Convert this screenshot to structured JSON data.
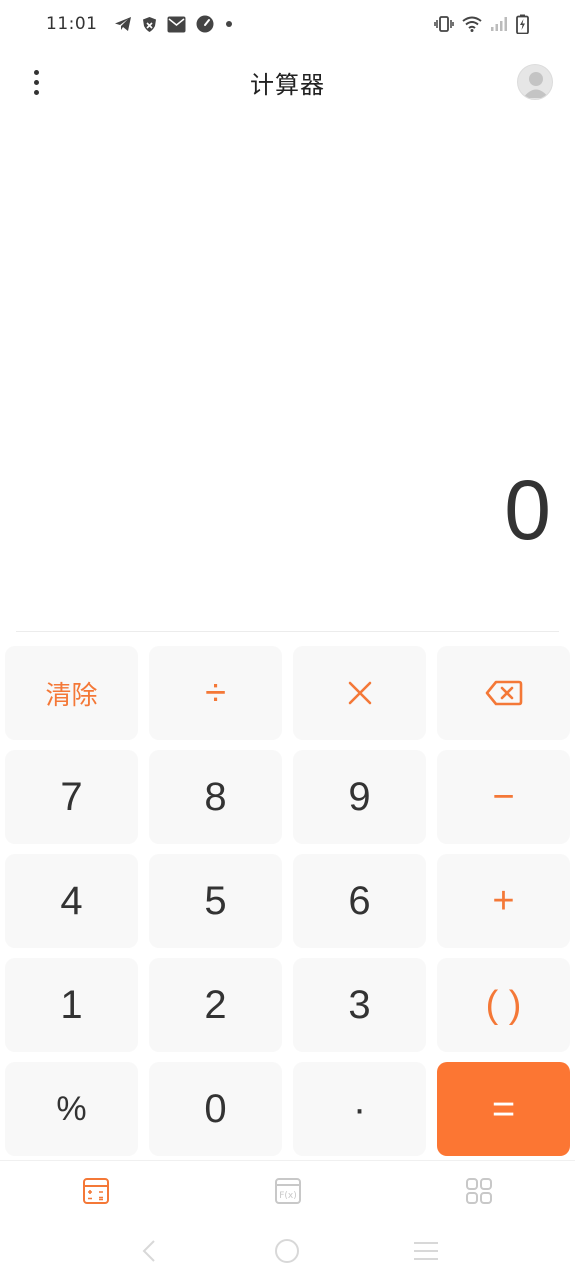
{
  "status_bar": {
    "time": "11:01",
    "left_icons": [
      "telegram-icon",
      "shield-icon",
      "mail-icon",
      "speedometer-icon",
      "dot-icon"
    ],
    "right_icons": [
      "vibrate-icon",
      "wifi-icon",
      "cellular-signal-icon",
      "battery-charging-icon"
    ]
  },
  "header": {
    "title": "计算器",
    "menu_icon": "more-vertical-icon",
    "avatar_icon": "user-avatar-icon"
  },
  "display": {
    "value": "0"
  },
  "keypad": {
    "row1": [
      "清除",
      "÷",
      "×",
      "⌫"
    ],
    "row2": [
      "7",
      "8",
      "9",
      "−"
    ],
    "row3": [
      "4",
      "5",
      "6",
      "+"
    ],
    "row4": [
      "1",
      "2",
      "3",
      "( )"
    ],
    "row5": [
      "%",
      "0",
      "·",
      "="
    ]
  },
  "bottom_nav": {
    "tabs": [
      {
        "icon": "calculator-icon",
        "active": true
      },
      {
        "icon": "function-fx-icon",
        "active": false
      },
      {
        "icon": "grid-apps-icon",
        "active": false
      }
    ]
  },
  "colors": {
    "accent": "#f47837",
    "equals_bg": "#fc7633",
    "key_bg": "#f8f8f8",
    "text": "#333333",
    "inactive_icon": "#c8c8c8"
  }
}
